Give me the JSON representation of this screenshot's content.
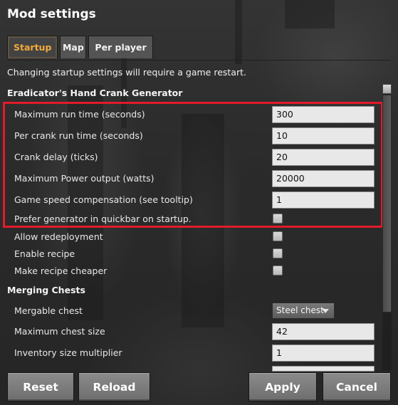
{
  "window": {
    "title": "Mod settings"
  },
  "tabs": [
    {
      "label": "Startup",
      "active": true
    },
    {
      "label": "Map",
      "active": false
    },
    {
      "label": "Per player",
      "active": false
    }
  ],
  "notice": "Changing startup settings will require a game restart.",
  "sections": {
    "hand_crank": {
      "title": "Eradicator's Hand Crank Generator",
      "settings": [
        {
          "label": "Maximum run time (seconds)",
          "type": "text",
          "value": "300"
        },
        {
          "label": "Per crank run time (seconds)",
          "type": "text",
          "value": "10"
        },
        {
          "label": "Crank delay (ticks)",
          "type": "text",
          "value": "20"
        },
        {
          "label": "Maximum Power output (watts)",
          "type": "text",
          "value": "20000"
        },
        {
          "label": "Game speed compensation (see tooltip)",
          "type": "text",
          "value": "1"
        },
        {
          "label": "Prefer generator in quickbar on startup.",
          "type": "checkbox",
          "checked": false
        },
        {
          "label": "Allow redeployment",
          "type": "checkbox",
          "checked": false
        },
        {
          "label": "Enable recipe",
          "type": "checkbox",
          "checked": false
        },
        {
          "label": "Make recipe cheaper",
          "type": "checkbox",
          "checked": false
        }
      ]
    },
    "merging_chests": {
      "title": "Merging Chests",
      "settings": [
        {
          "label": "Mergable chest",
          "type": "dropdown",
          "value": "Steel chest"
        },
        {
          "label": "Maximum chest size",
          "type": "text",
          "value": "42"
        },
        {
          "label": "Inventory size multiplier",
          "type": "text",
          "value": "1"
        }
      ]
    }
  },
  "buttons": {
    "reset": "Reset",
    "reload": "Reload",
    "apply": "Apply",
    "cancel": "Cancel"
  },
  "colors": {
    "active_tab": "#f3a93b",
    "highlight_box": "#e21b2a"
  },
  "icons": {
    "dropdown": "chevron-down-icon"
  }
}
